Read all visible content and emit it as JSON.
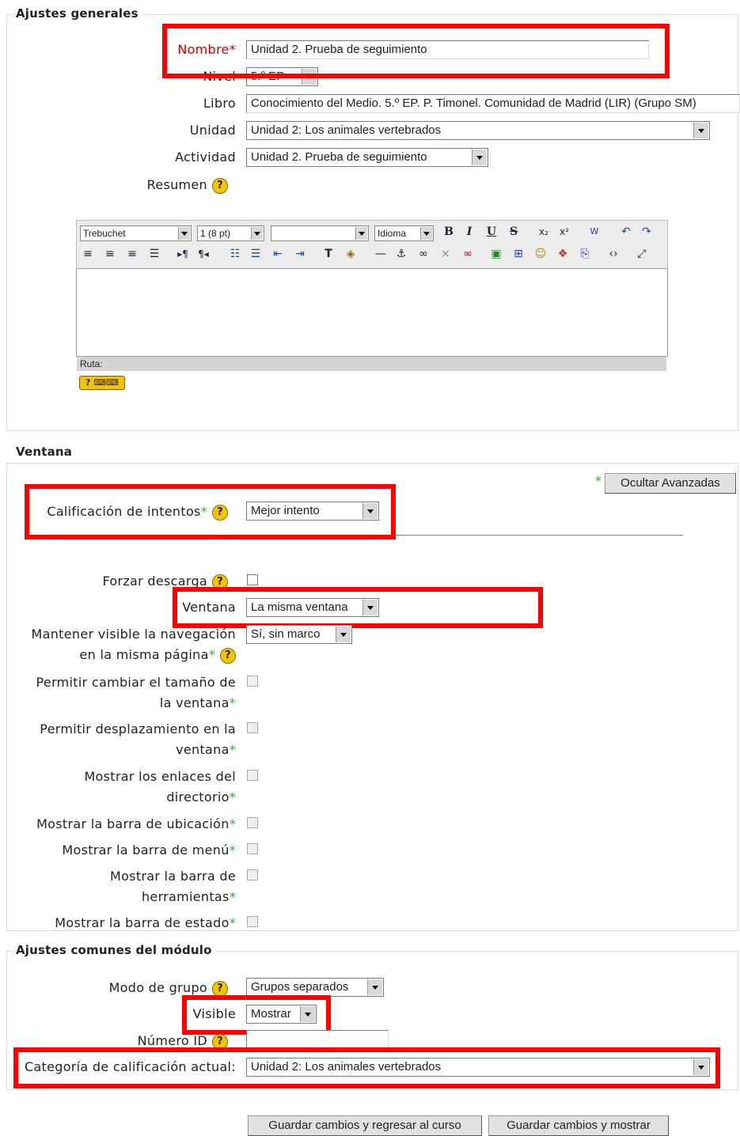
{
  "general": {
    "legend": "Ajustes generales",
    "nombre_label": "Nombre",
    "nombre_value": "Unidad 2. Prueba de seguimiento",
    "nivel_label": "Nivel",
    "nivel_value": "5.º EP",
    "libro_label": "Libro",
    "libro_value": "Conocimiento del Medio. 5.º EP. P. Timonel. Comunidad de Madrid (LIR) (Grupo SM)",
    "unidad_label": "Unidad",
    "unidad_value": "Unidad 2: Los animales vertebrados",
    "actividad_label": "Actividad",
    "actividad_value": "Unidad 2. Prueba de seguimiento",
    "resumen_label": "Resumen",
    "editor": {
      "font": "Trebuchet",
      "size": "1 (8 pt)",
      "format": "",
      "lang": "Idioma",
      "path_label": "Ruta:"
    }
  },
  "ventana": {
    "legend": "Ventana",
    "toggle_button": "Ocultar Avanzadas",
    "calificacion_label": "Calificación de intentos",
    "calificacion_value": "Mejor intento",
    "forzar_label": "Forzar descarga",
    "ventana_label": "Ventana",
    "ventana_value": "La misma ventana",
    "mantener_label": "Mantener visible la navegación en la misma página",
    "mantener_value": "Sí, sin marco",
    "cambiar_label": "Permitir cambiar el tamaño de la ventana",
    "desplaz_label": "Permitir desplazamiento en la ventana",
    "enlaces_label": "Mostrar los enlaces del directorio",
    "ubicacion_label": "Mostrar la barra de ubicación",
    "menu_label": "Mostrar la barra de menú",
    "herramientas_label": "Mostrar la barra de herramientas",
    "estado_label": "Mostrar la barra de estado"
  },
  "comunes": {
    "legend": "Ajustes comunes del módulo",
    "grupo_label": "Modo de grupo",
    "grupo_value": "Grupos separados",
    "visible_label": "Visible",
    "visible_value": "Mostrar",
    "numero_label": "Número ID",
    "numero_value": "",
    "categoria_label": "Categoría de calificación actual:",
    "categoria_value": "Unidad 2: Los animales vertebrados"
  },
  "buttons": {
    "save_return": "Guardar cambios y regresar al curso",
    "save_show": "Guardar cambios y mostrar"
  },
  "symbols": {
    "required": "*",
    "help": "?"
  },
  "colors": {
    "highlight": "#ff0000",
    "required": "#33aa33",
    "error_label": "#cc0000"
  }
}
